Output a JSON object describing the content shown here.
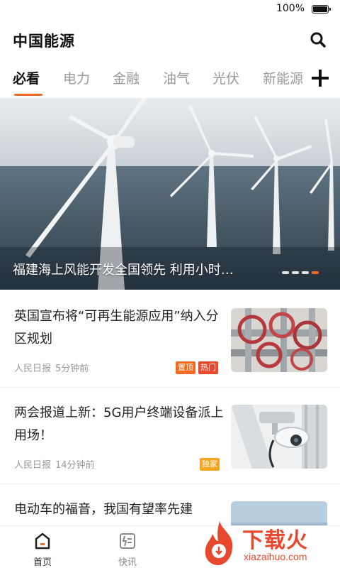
{
  "status_bar": {
    "battery_text": "100%"
  },
  "header": {
    "title": "中国能源",
    "search_icon": "search-icon"
  },
  "tabs": {
    "items": [
      {
        "label": "必看",
        "active": true
      },
      {
        "label": "电力",
        "active": false
      },
      {
        "label": "金融",
        "active": false
      },
      {
        "label": "油气",
        "active": false
      },
      {
        "label": "光伏",
        "active": false
      },
      {
        "label": "新能源",
        "active": false
      }
    ],
    "add_icon": "plus-icon"
  },
  "banner": {
    "caption": "福建海上风能开发全国领先 利用小时…",
    "slide_count": 4,
    "active_slide": 3
  },
  "news": [
    {
      "title": "英国宣布将“可再生能源应用”纳入分区规划",
      "source": "人民日报",
      "time": "5分钟前",
      "badges": [
        {
          "label": "置顶",
          "color": "#f26b21"
        },
        {
          "label": "热门",
          "color": "#e8492e"
        }
      ],
      "thumb_icon": "valves-image"
    },
    {
      "title": "两会报道上新：5G用户终端设备派上用场！",
      "source": "人民日报",
      "time": "14分钟前",
      "badges": [
        {
          "label": "独家",
          "color": "#f5a623"
        }
      ],
      "thumb_icon": "security-camera-image"
    },
    {
      "title": "电动车的福音，我国有望率先建",
      "source": "",
      "time": "",
      "badges": [],
      "thumb_icon": "sky-image"
    }
  ],
  "bottom_nav": [
    {
      "label": "首页",
      "icon": "home-icon",
      "active": true
    },
    {
      "label": "快讯",
      "icon": "flash-news-icon",
      "active": false
    }
  ],
  "watermark": {
    "text": "下载火",
    "sub": "xiazaihuo.com"
  },
  "colors": {
    "accent": "#f26b21",
    "hot": "#e8492e",
    "exclusive": "#f5a623"
  }
}
